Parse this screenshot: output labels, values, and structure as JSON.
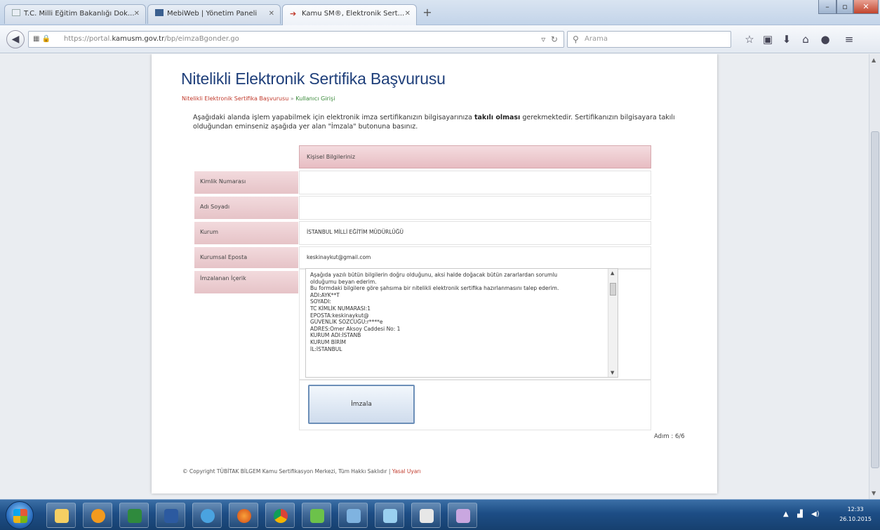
{
  "browser": {
    "tabs": [
      {
        "label": "T.C. Milli Eğitim Bakanlığı Dok...",
        "active": false
      },
      {
        "label": "MebiWeb | Yönetim Paneli",
        "active": false
      },
      {
        "label": "Kamu SM®, Elektronik Sert...",
        "active": true
      }
    ],
    "new_tab": "+",
    "url_prefix": "https://portal.",
    "url_domain": "kamusm.gov.tr",
    "url_path": "/bp/eimzaBgonder.go",
    "search_placeholder": "Arama"
  },
  "page": {
    "title": "Nitelikli Elektronik Sertifika Başvurusu",
    "breadcrumb": {
      "link": "Nitelikli Elektronik Sertifika Başvurusu",
      "separator": "»",
      "current": "Kullanıcı Girişi"
    },
    "intro_pre": "Aşağıdaki alanda işlem yapabilmek için elektronik imza sertifikanızın bilgisayarınıza ",
    "intro_bold": "takılı olması",
    "intro_post": " gerekmektedir. Sertifikanızın bilgisayara takılı olduğundan eminseniz aşağıda yer alan \"İmzala\" butonuna basınız.",
    "form": {
      "header": "Kişisel Bilgileriniz",
      "rows": [
        {
          "label": "Kimlik Numarası",
          "value": ""
        },
        {
          "label": "Adı Soyadı",
          "value": ""
        },
        {
          "label": "Kurum",
          "value": "İSTANBUL MİLLİ EĞİTİM MÜDÜRLÜĞÜ"
        },
        {
          "label": "Kurumsal Eposta",
          "value": "keskinaykut@gmail.com"
        },
        {
          "label": "İmzalanan İçerik",
          "value": ""
        }
      ],
      "content_lines": [
        "Aşağıda yazılı bütün bilgilerin doğru olduğunu, aksi halde doğacak bütün zararlardan sorumlu",
        "olduğumu beyan ederim.",
        "Bu formdaki bilgilere göre şahsıma bir nitelikli elektronik sertifika hazırlanmasını talep ederim.",
        "ADI:AYK**T",
        "SOYADI:",
        "TC KİMLİK NUMARASI:1",
        "EPOSTA:keskinaykut@",
        "GÜVENLİK SÖZCÜĞÜ:r****e",
        "ADRES:Ömer Aksoy Caddesi No: 1",
        "KURUM ADI:İSTANB",
        "KURUM BİRİM",
        "İL:İSTANBUL"
      ],
      "sign_button": "İmzala"
    },
    "step": "Adım : 6/6",
    "footer_text": "© Copyright TÜBİTAK BİLGEM Kamu Sertifikasyon Merkezi, Tüm Hakkı Saklıdır",
    "footer_sep": "|",
    "footer_link": "Yasal Uyarı"
  },
  "taskbar": {
    "time": "12:33",
    "date": "26.10.2015"
  }
}
